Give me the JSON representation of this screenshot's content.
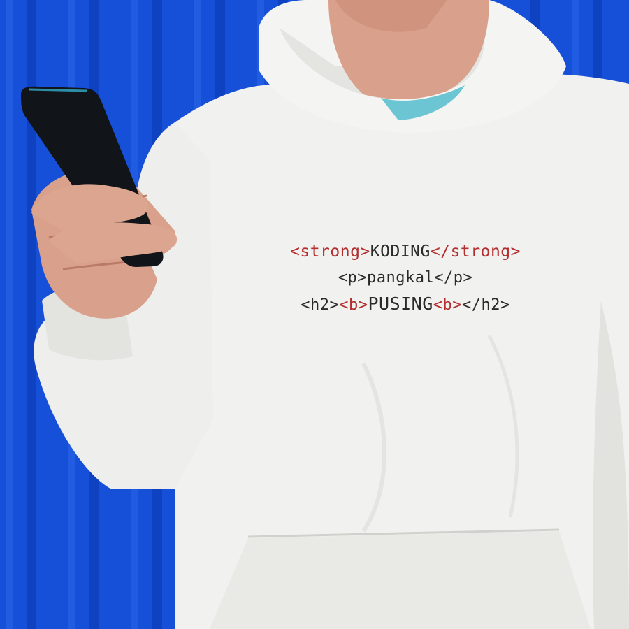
{
  "scene": {
    "colors": {
      "wall_blue": "#1650d8",
      "wall_dark": "#0d3bb0",
      "hoodie_white": "#f1f1ef",
      "hoodie_shadow": "#d9d9d6",
      "skin": "#d9a08b",
      "tshirt_teal": "#6cc5d3",
      "phone_black": "#111418",
      "print_red": "#b32e2e",
      "print_dark": "#2a2a2a"
    }
  },
  "print": {
    "line1": {
      "open_tag": "<strong>",
      "word": "KODING",
      "close_tag": "</strong>"
    },
    "line2": {
      "open_tag": "<p>",
      "word": "pangkal",
      "close_tag": "</p>"
    },
    "line3": {
      "outer_open": "<h2>",
      "inner_open": "<b>",
      "word": "PUSING",
      "inner_close": "<b>",
      "outer_close": "</h2>"
    }
  }
}
